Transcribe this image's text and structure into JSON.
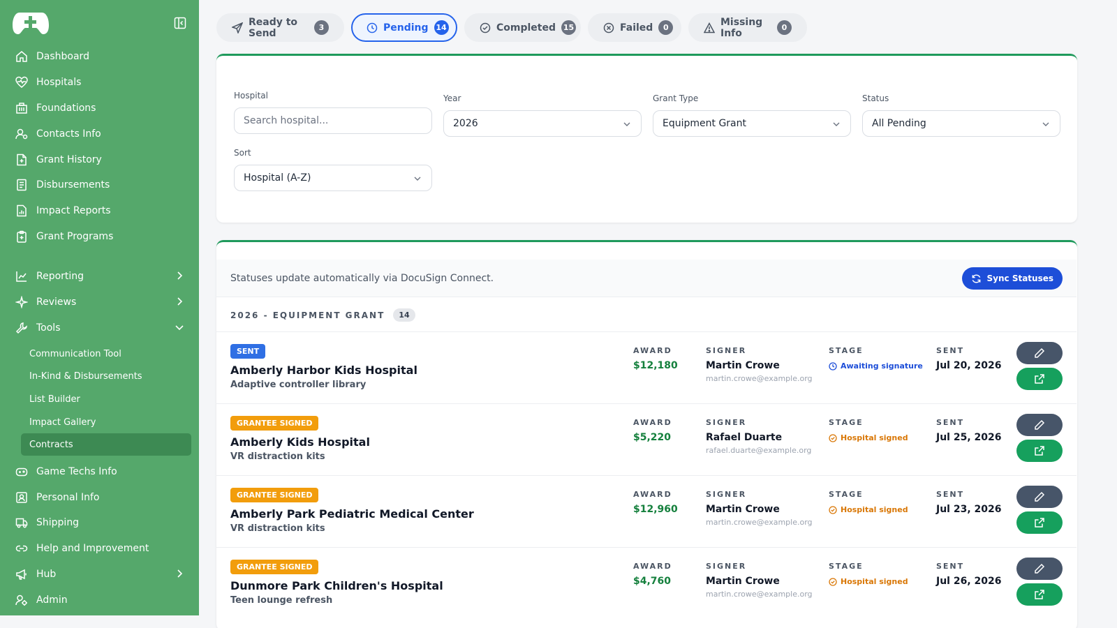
{
  "sidebar": {
    "main_items": [
      {
        "label": "Dashboard",
        "icon": "home-icon"
      },
      {
        "label": "Hospitals",
        "icon": "heart-pulse-icon"
      },
      {
        "label": "Foundations",
        "icon": "building-icon"
      },
      {
        "label": "Contacts Info",
        "icon": "user-contact-icon"
      },
      {
        "label": "Grant History",
        "icon": "file-plus-icon"
      },
      {
        "label": "Disbursements",
        "icon": "receipt-icon"
      },
      {
        "label": "Impact Reports",
        "icon": "file-chart-icon"
      },
      {
        "label": "Grant Programs",
        "icon": "clipboard-plus-icon"
      }
    ],
    "group_items": [
      {
        "label": "Reporting",
        "icon": "line-chart-icon",
        "chevron": "right"
      },
      {
        "label": "Reviews",
        "icon": "sparkle-icon",
        "chevron": "right"
      },
      {
        "label": "Tools",
        "icon": "wrench-icon",
        "chevron": "down"
      }
    ],
    "tools_subitems": [
      "Communication Tool",
      "In-Kind & Disbursements",
      "List Builder",
      "Impact Gallery",
      "Contracts"
    ],
    "active_subitem": "Contracts",
    "bottom_items": [
      {
        "label": "Game Techs Info",
        "icon": "gamepad-icon"
      },
      {
        "label": "Personal Info",
        "icon": "id-card-icon"
      },
      {
        "label": "Shipping",
        "icon": "truck-icon"
      },
      {
        "label": "Help and Improvement",
        "icon": "link-icon"
      },
      {
        "label": "Hub",
        "icon": "megaphone-icon",
        "chevron": "right"
      },
      {
        "label": "Admin",
        "icon": "admin-icon"
      }
    ]
  },
  "tabs": [
    {
      "label": "Ready to Send",
      "count": "3",
      "icon": "send-icon"
    },
    {
      "label": "Pending",
      "count": "14",
      "icon": "clock-icon",
      "active": true
    },
    {
      "label": "Completed",
      "count": "15",
      "icon": "check-circle-icon"
    },
    {
      "label": "Failed",
      "count": "0",
      "icon": "x-circle-icon"
    },
    {
      "label": "Missing Info",
      "count": "0",
      "icon": "warning-icon"
    }
  ],
  "filters": {
    "hospital_label": "Hospital",
    "hospital_placeholder": "Search hospital...",
    "year_label": "Year",
    "year_value": "2026",
    "grant_type_label": "Grant Type",
    "grant_type_value": "Equipment Grant",
    "status_label": "Status",
    "status_value": "All Pending",
    "sort_label": "Sort",
    "sort_value": "Hospital (A-Z)"
  },
  "contracts": {
    "info_text": "Statuses update automatically via DocuSign Connect.",
    "sync_label": "Sync Statuses",
    "group_title": "2026 - EQUIPMENT GRANT",
    "group_count": "14",
    "col_award": "AWARD",
    "col_signer": "SIGNER",
    "col_stage": "STAGE",
    "col_sent": "SENT",
    "rows": [
      {
        "badge": "SENT",
        "badge_kind": "sent",
        "hospital": "Amberly Harbor Kids Hospital",
        "project": "Adaptive controller library",
        "award": "$12,180",
        "signer": "Martin Crowe",
        "email": "martin.crowe@example.org",
        "stage": "Awaiting signature",
        "stage_kind": "await",
        "sent": "Jul 20, 2026"
      },
      {
        "badge": "GRANTEE SIGNED",
        "badge_kind": "signed",
        "hospital": "Amberly Kids Hospital",
        "project": "VR distraction kits",
        "award": "$5,220",
        "signer": "Rafael Duarte",
        "email": "rafael.duarte@example.org",
        "stage": "Hospital signed",
        "stage_kind": "hsigned",
        "sent": "Jul 25, 2026"
      },
      {
        "badge": "GRANTEE SIGNED",
        "badge_kind": "signed",
        "hospital": "Amberly Park Pediatric Medical Center",
        "project": "VR distraction kits",
        "award": "$12,960",
        "signer": "Martin Crowe",
        "email": "martin.crowe@example.org",
        "stage": "Hospital signed",
        "stage_kind": "hsigned",
        "sent": "Jul 23, 2026"
      },
      {
        "badge": "GRANTEE SIGNED",
        "badge_kind": "signed",
        "hospital": "Dunmore Park Children's Hospital",
        "project": "Teen lounge refresh",
        "award": "$4,760",
        "signer": "Martin Crowe",
        "email": "martin.crowe@example.org",
        "stage": "Hospital signed",
        "stage_kind": "hsigned",
        "sent": "Jul 26, 2026"
      }
    ]
  },
  "colors": {
    "sidebar": "#55a86b",
    "accent_blue": "#2563eb",
    "award_green": "#15803d",
    "sent_badge": "#2f6fe4",
    "signed_badge": "#f29d0c"
  }
}
